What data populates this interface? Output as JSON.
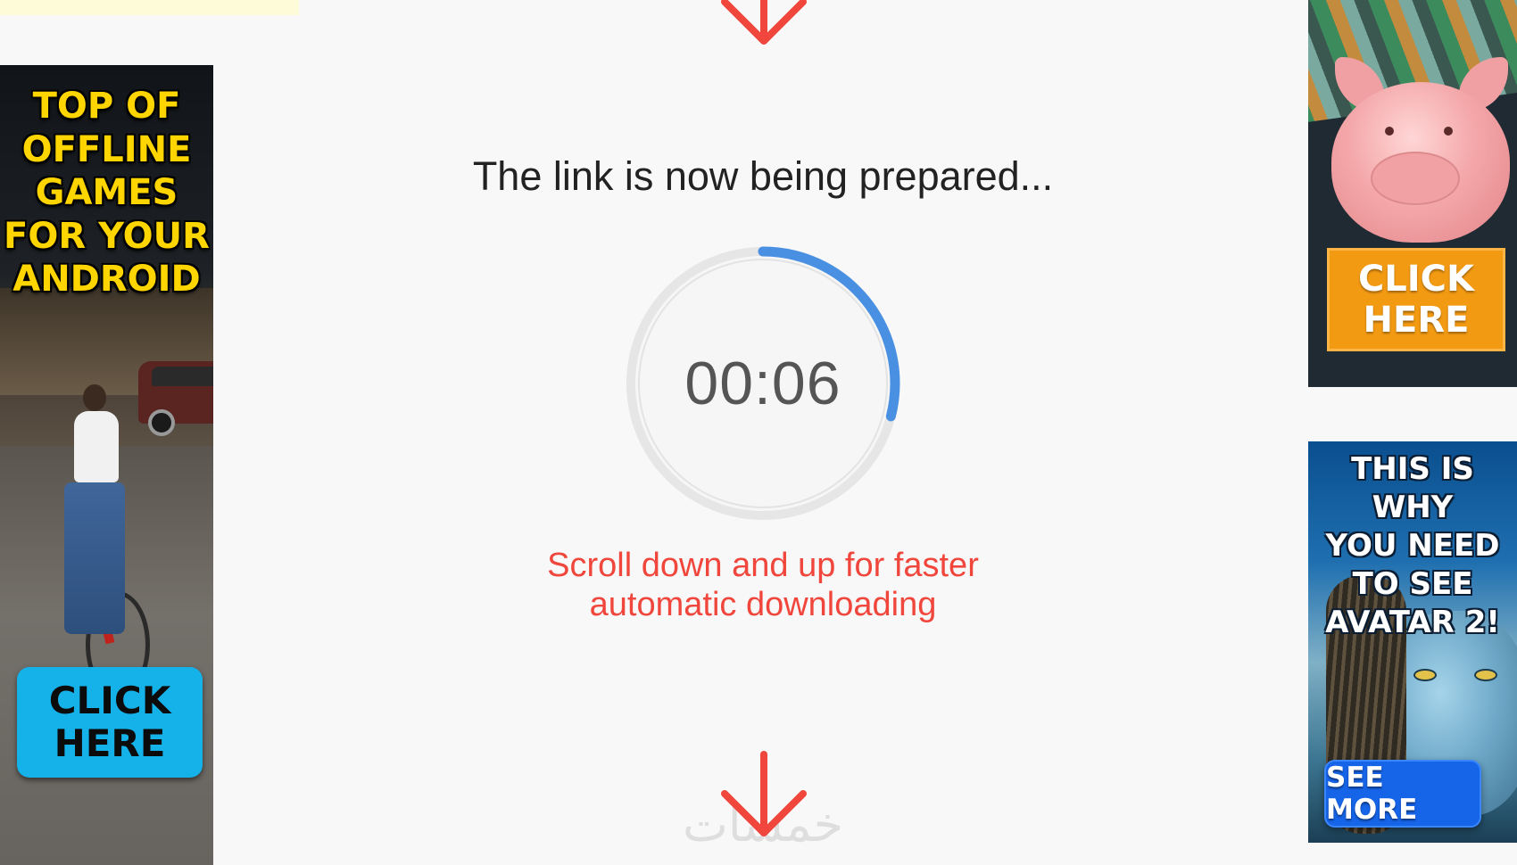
{
  "status": {
    "title": "The link is now being prepared...",
    "timer": "00:06",
    "progress_fraction": 0.29,
    "hint_line1": "Scroll down and up for faster",
    "hint_line2": "automatic downloading"
  },
  "ads": {
    "left": {
      "headline": [
        "TOP OF",
        "OFFLINE",
        "GAMES",
        "FOR YOUR",
        "ANDROID"
      ],
      "cta": [
        "CLICK",
        "HERE"
      ]
    },
    "right_top": {
      "cta": [
        "CLICK",
        "HERE"
      ]
    },
    "right_bottom": {
      "headline": [
        "THIS IS WHY",
        "YOU NEED",
        "TO SEE",
        "AVATAR 2!"
      ],
      "cta": "SEE MORE"
    }
  },
  "watermark": "خمسات",
  "colors": {
    "arrow": "#f0463b",
    "progress": "#4a90e2",
    "ring": "#e6e6e6",
    "hint": "#f0463b"
  },
  "icons": {
    "arrow_top": "arrow-down-icon",
    "arrow_bottom": "arrow-down-icon"
  }
}
